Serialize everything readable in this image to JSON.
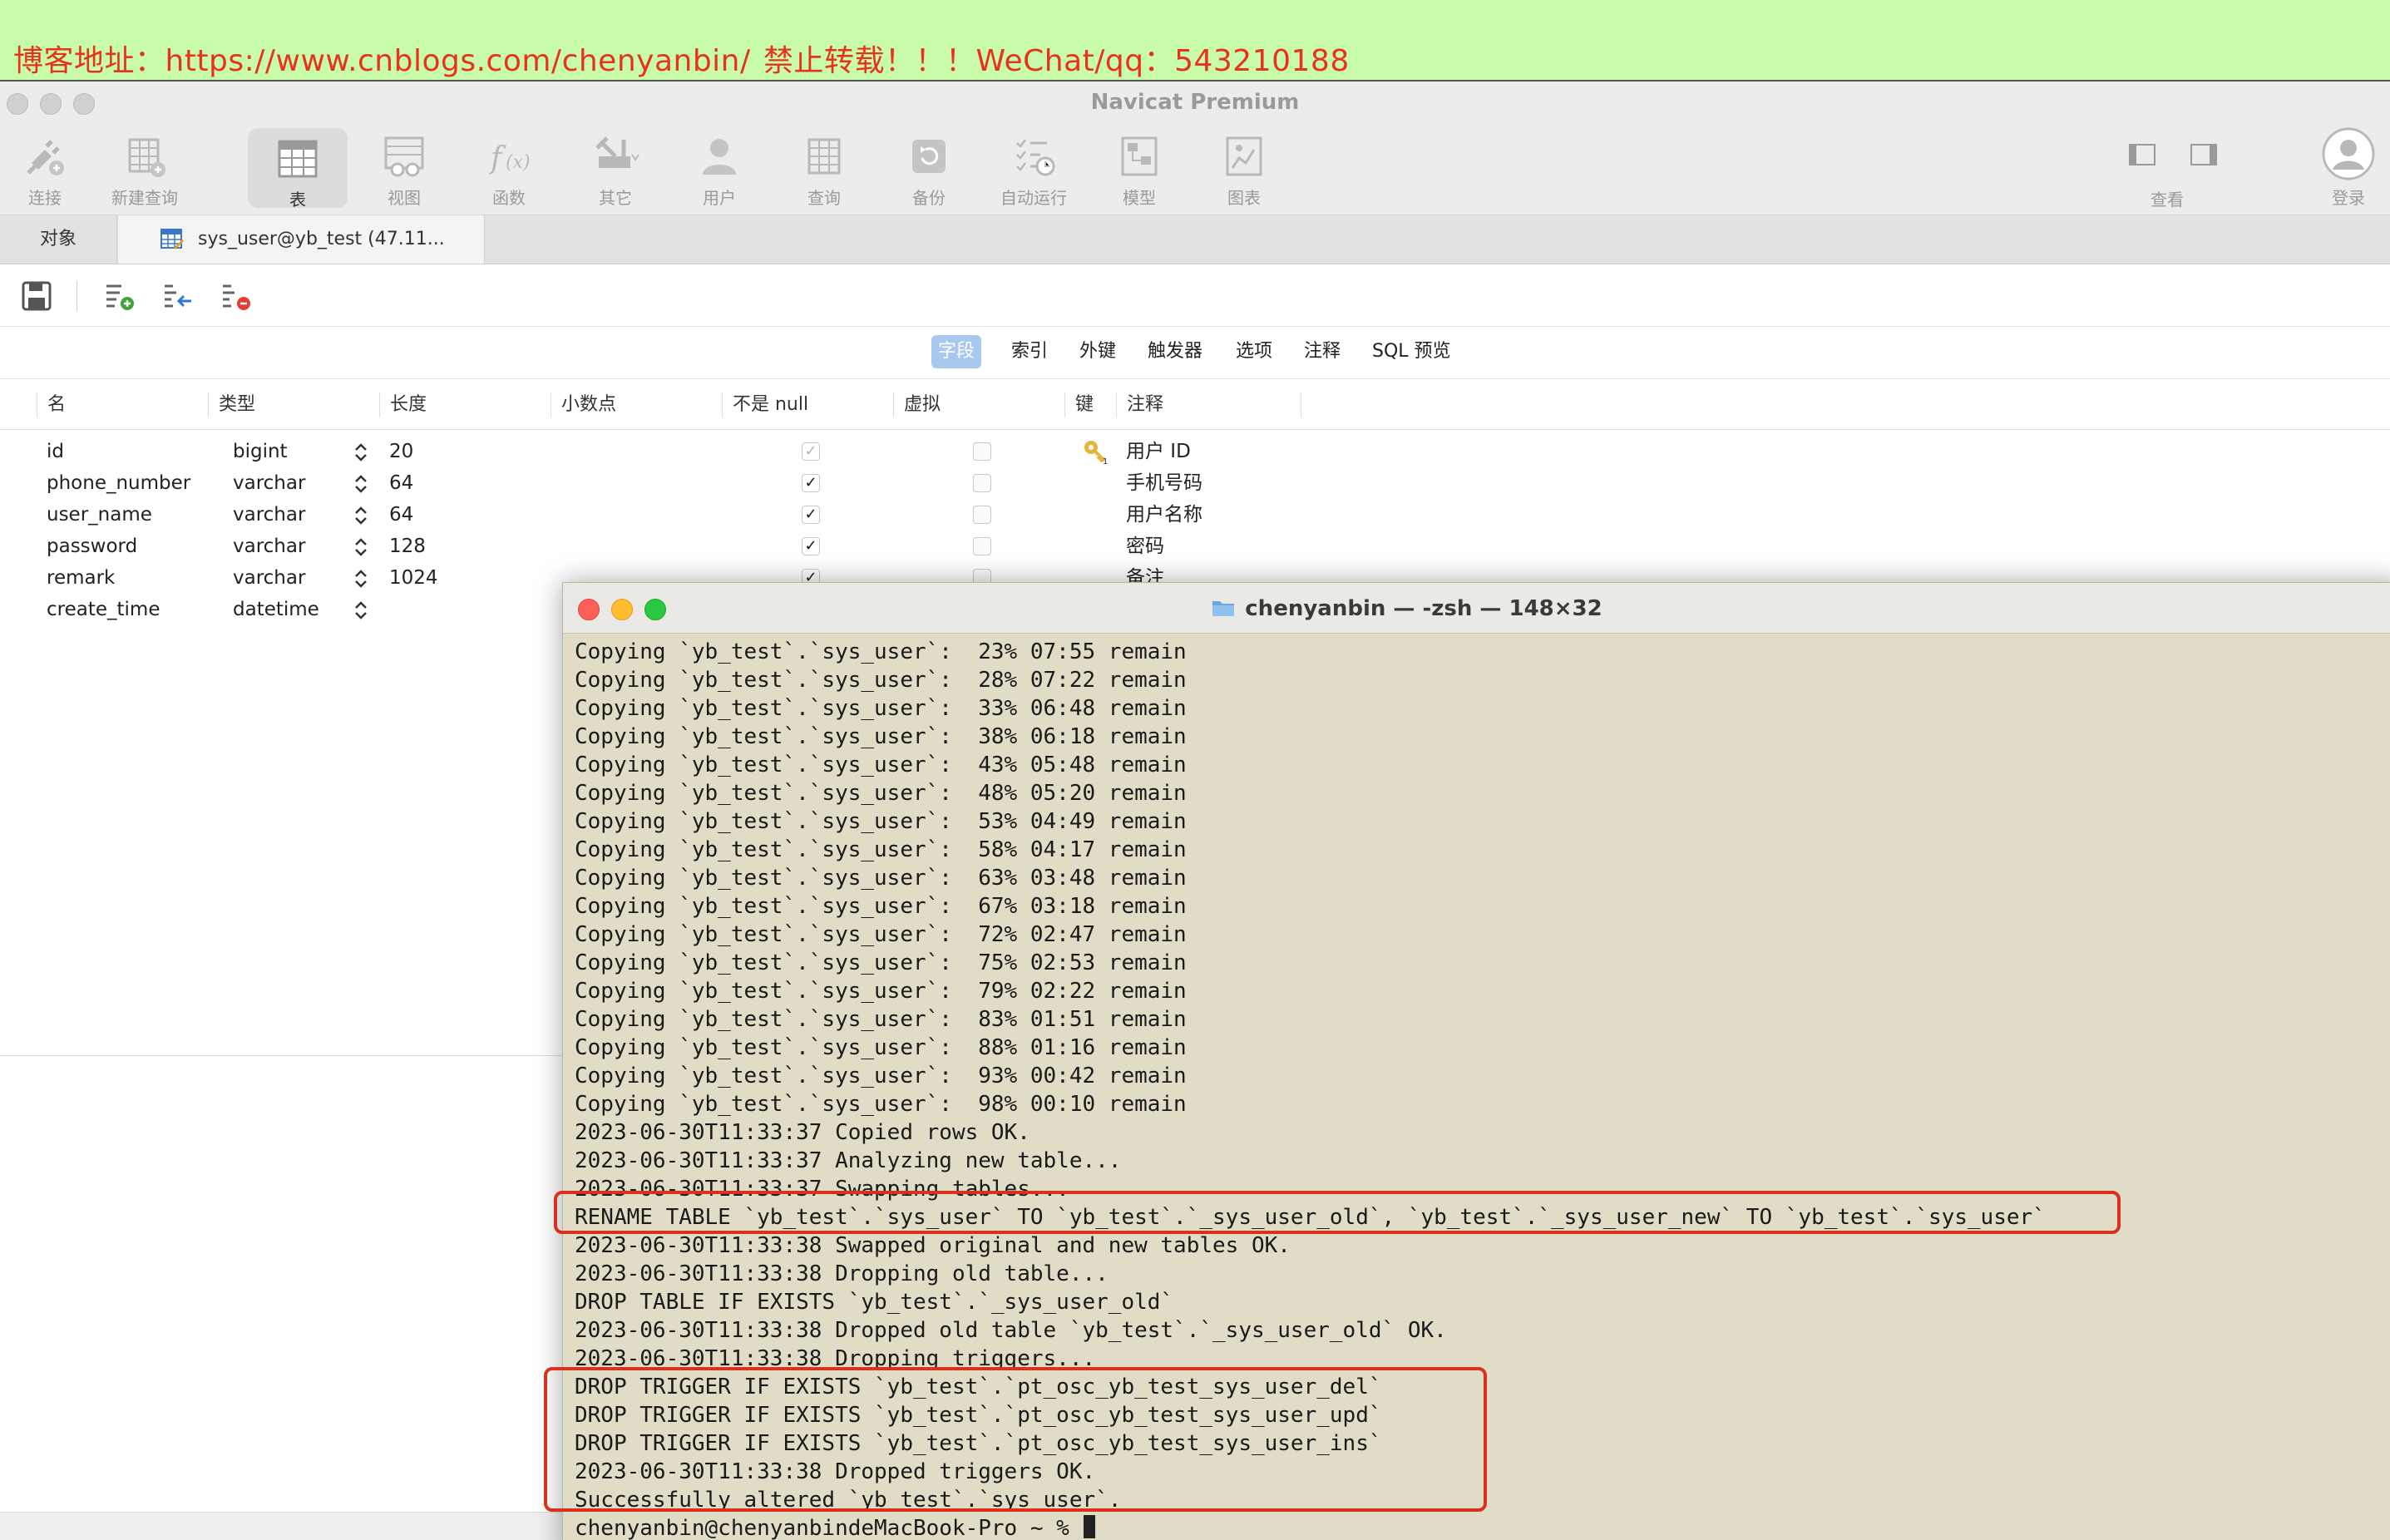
{
  "banner": {
    "blog": "博客地址：https://www.cnblogs.com/chenyanbin/",
    "notice": "禁止转载！！！WeChat/qq：543210188"
  },
  "window": {
    "title": "Navicat Premium"
  },
  "toolbar": {
    "items": [
      {
        "label": "连接",
        "icon": "connection-plug-icon"
      },
      {
        "label": "新建查询",
        "icon": "new-query-icon"
      },
      {
        "label": "表",
        "icon": "table-icon"
      },
      {
        "label": "视图",
        "icon": "view-icon"
      },
      {
        "label": "函数",
        "icon": "function-icon"
      },
      {
        "label": "其它",
        "icon": "tools-icon"
      },
      {
        "label": "用户",
        "icon": "user-icon"
      },
      {
        "label": "查询",
        "icon": "query-icon"
      },
      {
        "label": "备份",
        "icon": "backup-icon"
      },
      {
        "label": "自动运行",
        "icon": "automation-icon"
      },
      {
        "label": "模型",
        "icon": "model-icon"
      },
      {
        "label": "图表",
        "icon": "chart-icon"
      }
    ],
    "view_label": "查看",
    "login_label": "登录"
  },
  "tabs": {
    "objects": "对象",
    "table_tab": "sys_user@yb_test (47.11..."
  },
  "designer_tabs": [
    "字段",
    "索引",
    "外键",
    "触发器",
    "选项",
    "注释",
    "SQL 预览"
  ],
  "grid": {
    "headers": [
      "名",
      "类型",
      "长度",
      "小数点",
      "不是 null",
      "虚拟",
      "键",
      "注释"
    ],
    "rows": [
      {
        "name": "id",
        "type": "bigint",
        "length": "20",
        "not_null": true,
        "not_null_dim": true,
        "key": true,
        "comment": "用户 ID"
      },
      {
        "name": "phone_number",
        "type": "varchar",
        "length": "64",
        "not_null": true,
        "not_null_dim": false,
        "key": false,
        "comment": "手机号码"
      },
      {
        "name": "user_name",
        "type": "varchar",
        "length": "64",
        "not_null": true,
        "not_null_dim": false,
        "key": false,
        "comment": "用户名称"
      },
      {
        "name": "password",
        "type": "varchar",
        "length": "128",
        "not_null": true,
        "not_null_dim": false,
        "key": false,
        "comment": "密码"
      },
      {
        "name": "remark",
        "type": "varchar",
        "length": "1024",
        "not_null": true,
        "not_null_dim": false,
        "key": false,
        "comment": "备注"
      },
      {
        "name": "create_time",
        "type": "datetime",
        "length": "",
        "not_null": false,
        "not_null_dim": false,
        "key": false,
        "comment": ""
      }
    ]
  },
  "terminal": {
    "title": "chenyanbin — -zsh — 148×32",
    "lines": [
      "Copying `yb_test`.`sys_user`:  23% 07:55 remain",
      "Copying `yb_test`.`sys_user`:  28% 07:22 remain",
      "Copying `yb_test`.`sys_user`:  33% 06:48 remain",
      "Copying `yb_test`.`sys_user`:  38% 06:18 remain",
      "Copying `yb_test`.`sys_user`:  43% 05:48 remain",
      "Copying `yb_test`.`sys_user`:  48% 05:20 remain",
      "Copying `yb_test`.`sys_user`:  53% 04:49 remain",
      "Copying `yb_test`.`sys_user`:  58% 04:17 remain",
      "Copying `yb_test`.`sys_user`:  63% 03:48 remain",
      "Copying `yb_test`.`sys_user`:  67% 03:18 remain",
      "Copying `yb_test`.`sys_user`:  72% 02:47 remain",
      "Copying `yb_test`.`sys_user`:  75% 02:53 remain",
      "Copying `yb_test`.`sys_user`:  79% 02:22 remain",
      "Copying `yb_test`.`sys_user`:  83% 01:51 remain",
      "Copying `yb_test`.`sys_user`:  88% 01:16 remain",
      "Copying `yb_test`.`sys_user`:  93% 00:42 remain",
      "Copying `yb_test`.`sys_user`:  98% 00:10 remain",
      "2023-06-30T11:33:37 Copied rows OK.",
      "2023-06-30T11:33:37 Analyzing new table...",
      "2023-06-30T11:33:37 Swapping tables...",
      "RENAME TABLE `yb_test`.`sys_user` TO `yb_test`.`_sys_user_old`, `yb_test`.`_sys_user_new` TO `yb_test`.`sys_user`",
      "2023-06-30T11:33:38 Swapped original and new tables OK.",
      "2023-06-30T11:33:38 Dropping old table...",
      "DROP TABLE IF EXISTS `yb_test`.`_sys_user_old`",
      "2023-06-30T11:33:38 Dropped old table `yb_test`.`_sys_user_old` OK.",
      "2023-06-30T11:33:38 Dropping triggers...",
      "DROP TRIGGER IF EXISTS `yb_test`.`pt_osc_yb_test_sys_user_del`",
      "DROP TRIGGER IF EXISTS `yb_test`.`pt_osc_yb_test_sys_user_upd`",
      "DROP TRIGGER IF EXISTS `yb_test`.`pt_osc_yb_test_sys_user_ins`",
      "2023-06-30T11:33:38 Dropped triggers OK.",
      "Successfully altered `yb_test`.`sys_user`.",
      "chenyanbin@chenyanbindeMacBook-Pro ~ % "
    ]
  },
  "colors": {
    "banner_bg": "#c8fcaa",
    "banner_text": "#e8321c",
    "terminal_bg": "#e0dcc6",
    "highlight": "#d8321f",
    "selected_tab": "#a9c8ee"
  }
}
